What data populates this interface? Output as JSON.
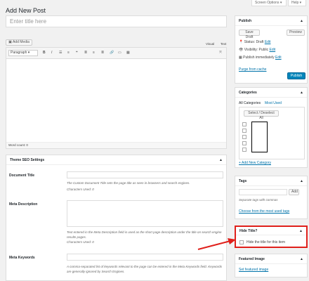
{
  "top_tabs": {
    "screen_options": "Screen Options ▾",
    "help": "Help ▾"
  },
  "page_title": "Add New Post",
  "title_placeholder": "Enter title here",
  "editor": {
    "add_media": "Add Media",
    "visual_tab": "Visual",
    "text_tab": "Text",
    "format_select": "Paragraph",
    "word_count": "Word count: 0"
  },
  "seo": {
    "title": "Theme SEO Settings",
    "doc_title_label": "Document Title",
    "doc_title_help": "The Custom Document Title sets the page title as seen in browsers and search engines.",
    "doc_title_chars": "Characters Used: 0",
    "meta_desc_label": "Meta Description",
    "meta_desc_help": "Text entered in the Meta Description field is used as the short page description under the title on search engine results pages.",
    "meta_desc_chars": "Characters Used: 0",
    "meta_kw_label": "Meta Keywords",
    "meta_kw_help": "A comma-separated list of keywords relevant to the page can be entered in the Meta Keywords field. Keywords are generally ignored by Search Engines."
  },
  "publish": {
    "title": "Publish",
    "save_draft": "Save Draft",
    "preview": "Preview",
    "status": "Status: Draft",
    "visibility": "Visibility: Public",
    "schedule": "Publish immediately",
    "edit": "Edit",
    "purge": "Purge from cache",
    "publish_btn": "Publish"
  },
  "categories": {
    "title": "Categories",
    "all_tab": "All Categories",
    "most_used_tab": "Most Used",
    "select_all": "Select / Deselect All",
    "add_new": "+ Add New Category"
  },
  "tags": {
    "title": "Tags",
    "add_btn": "Add",
    "hint": "Separate tags with commas",
    "choose": "Choose from the most used tags"
  },
  "hide_title": {
    "title": "Hide Title?",
    "checkbox_label": "Hide the title for this item"
  },
  "featured": {
    "title": "Featured Image",
    "set_link": "Set featured image"
  },
  "colors": {
    "accent": "#0073aa",
    "highlight": "#e0201b"
  }
}
